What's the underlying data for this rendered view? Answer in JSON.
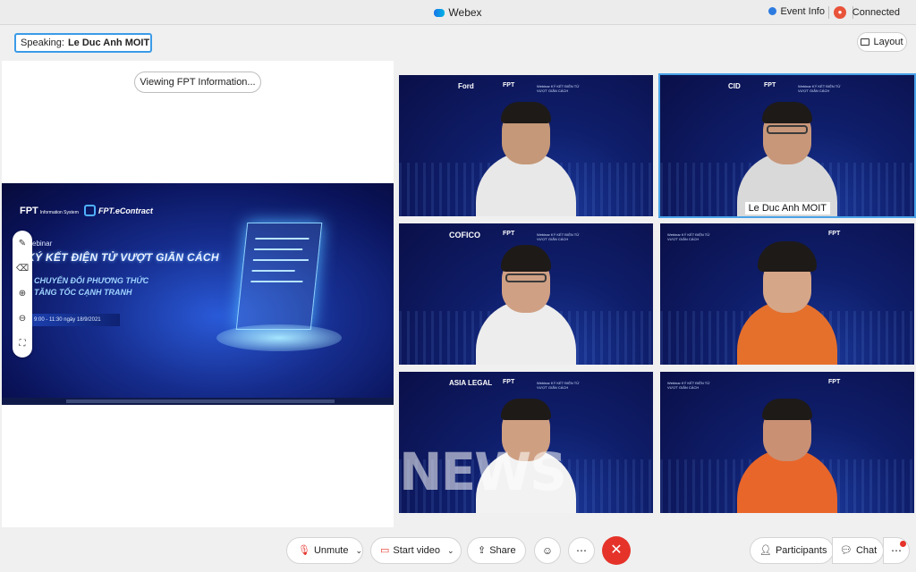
{
  "window": {
    "title": "Webex",
    "event_info": "Event Info",
    "recording_icon": "record-icon",
    "status": "Connected"
  },
  "header": {
    "speaking_label": "Speaking:",
    "speaking_name": "Le Duc Anh MOIT",
    "layout_label": "Layout"
  },
  "share": {
    "viewing_label": "Viewing FPT Information...",
    "slide": {
      "fpt_logo": "FPT",
      "fpt_logo_sub": "Information System",
      "econtract_logo": "FPT.eContract",
      "kicker": "ebinar",
      "headline": "KÝ KẾT ĐIỆN TỬ VƯỢT GIÃN CÁCH",
      "sub1": "CHUYỂN ĐỔI PHƯƠNG THỨC",
      "sub2": "TĂNG TỐC CẠNH TRANH",
      "date": "9:00 - 11:30 ngày 18/9/2021"
    },
    "annotation_tools": [
      "pen-icon",
      "eraser-icon",
      "zoom-in-icon",
      "zoom-out-icon",
      "fit-icon"
    ]
  },
  "participants": [
    {
      "sponsor": "Ford",
      "name_tag": "",
      "active": false
    },
    {
      "sponsor": "CID",
      "name_tag": "Le Duc Anh MOIT",
      "active": true
    },
    {
      "sponsor": "COFICO",
      "name_tag": "",
      "active": false
    },
    {
      "sponsor": "FPT",
      "name_tag": "",
      "active": false
    },
    {
      "sponsor": "ASIA LEGAL",
      "name_tag": "",
      "active": false,
      "watermark": "NEWS"
    },
    {
      "sponsor": "FPT",
      "name_tag": "",
      "active": false
    }
  ],
  "tile_branding": {
    "fpt": "FPT",
    "webinar": "Webinar KÝ KẾT ĐIỆN TỬ VƯỢT GIÃN CÁCH"
  },
  "toolbar": {
    "unmute": "Unmute",
    "start_video": "Start video",
    "share": "Share",
    "participants": "Participants",
    "chat": "Chat",
    "reactions_icon": "smiley-icon",
    "more_icon": "more-icon",
    "end_icon": "close-icon"
  },
  "colors": {
    "accent": "#3b9be8",
    "end_call": "#e5332a",
    "slide_bg": "#162d8e"
  }
}
